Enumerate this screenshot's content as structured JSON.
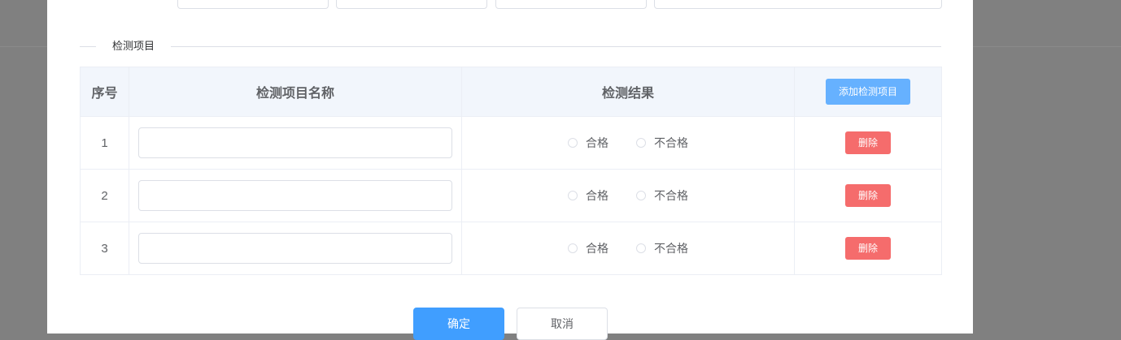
{
  "section": {
    "title": "检测项目"
  },
  "table": {
    "headers": {
      "index": "序号",
      "name": "检测项目名称",
      "result": "检测结果"
    },
    "add_label": "添加检测项目",
    "rows": [
      {
        "index": "1",
        "name_value": "",
        "pass_label": "合格",
        "fail_label": "不合格",
        "delete_label": "删除"
      },
      {
        "index": "2",
        "name_value": "",
        "pass_label": "合格",
        "fail_label": "不合格",
        "delete_label": "删除"
      },
      {
        "index": "3",
        "name_value": "",
        "pass_label": "合格",
        "fail_label": "不合格",
        "delete_label": "删除"
      }
    ]
  },
  "footer": {
    "confirm_label": "确定",
    "cancel_label": "取消"
  },
  "colors": {
    "primary": "#409eff",
    "add_button": "#66b1ff",
    "danger": "#f56c6c",
    "header_bg": "#f2f6fc"
  }
}
